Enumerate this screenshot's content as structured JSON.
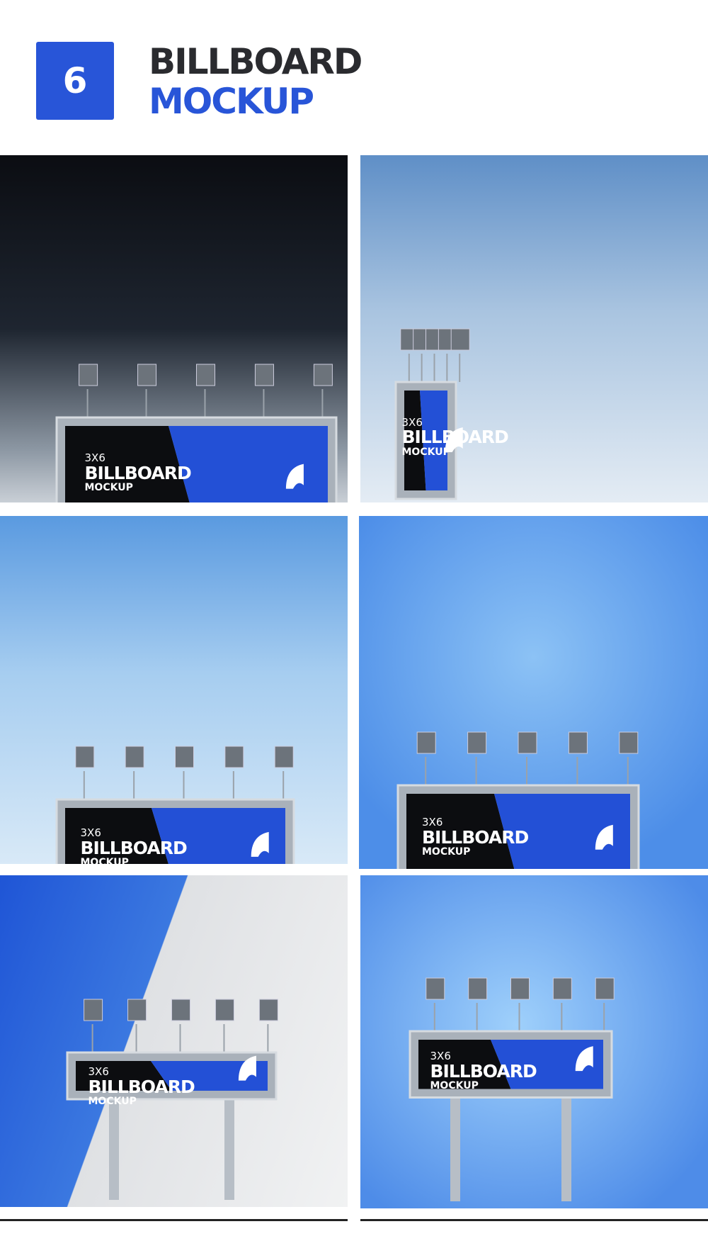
{
  "header": {
    "number": "6",
    "title_line1": "BILLBOARD",
    "title_line2": "MOCKUP"
  },
  "tiles": [
    {
      "size": "3X6",
      "title": "BILLBOARD",
      "subtitle": "MOCKUP"
    },
    {
      "size": "3X6",
      "title": "BILLBOARD",
      "subtitle": "MOCKUP"
    },
    {
      "size": "3X6",
      "title": "BILLBOARD",
      "subtitle": "MOCKUP"
    },
    {
      "size": "3X6",
      "title": "BILLBOARD",
      "subtitle": "MOCKUP"
    },
    {
      "size": "3X6",
      "title": "BILLBOARD",
      "subtitle": "MOCKUP"
    },
    {
      "size": "3X6",
      "title": "BILLBOARD",
      "subtitle": "MOCKUP"
    }
  ],
  "colors": {
    "brand": "#2855d8",
    "dark": "#2a2b2f"
  }
}
